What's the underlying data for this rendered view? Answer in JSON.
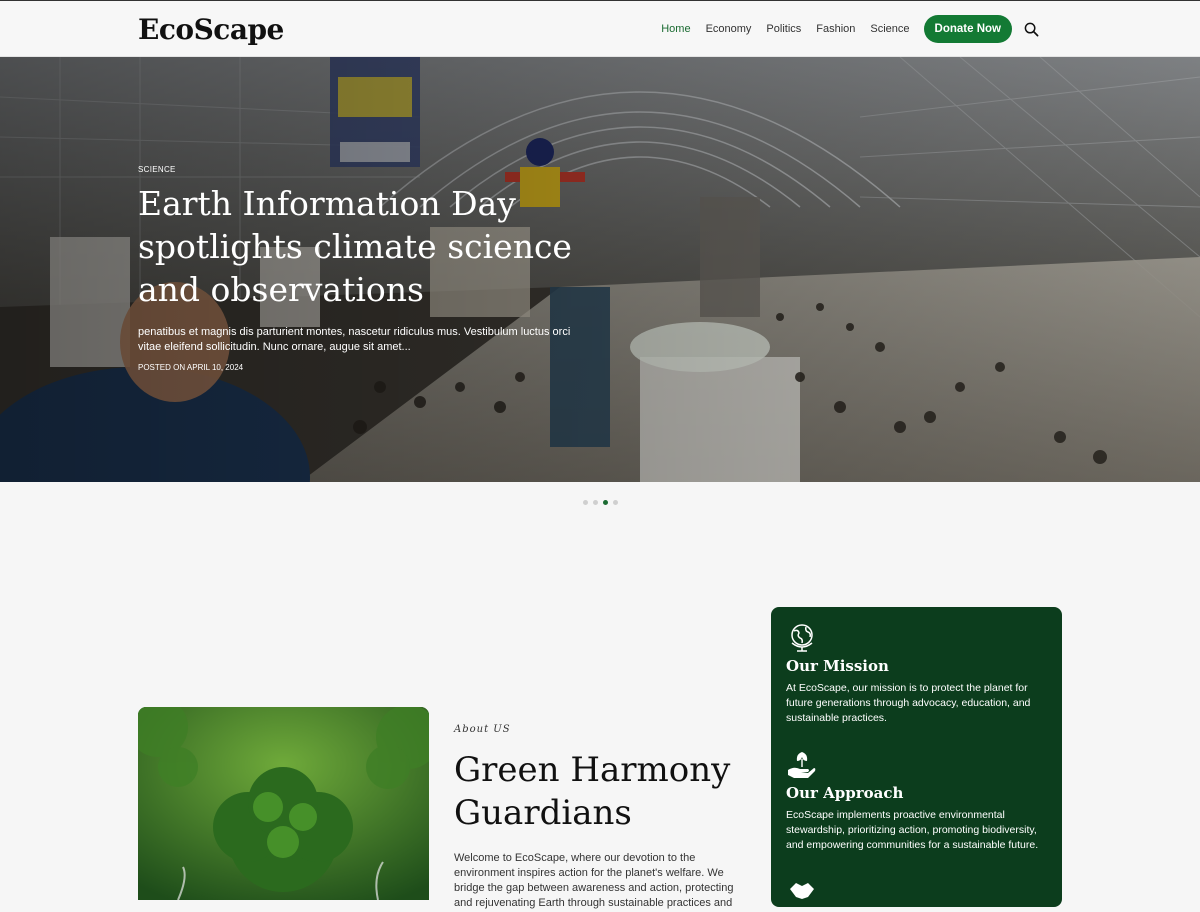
{
  "header": {
    "logo": "EcoScape",
    "nav": [
      "Home",
      "Economy",
      "Politics",
      "Fashion",
      "Science"
    ],
    "active_nav": "Home",
    "donate_label": "Donate Now",
    "accent": "#137a34"
  },
  "hero": {
    "category": "SCIENCE",
    "title": "Earth Information Day spotlights climate science and observations",
    "excerpt": "penatibus et magnis dis parturient montes, nascetur ridiculus mus. Vestibulum luctus orci vitae eleifend sollicitudin. Nunc ornare, augue sit amet...",
    "meta_prefix": "POSTED ON",
    "date": "APRIL 10, 2024",
    "slides": 4,
    "active_slide": 3
  },
  "about": {
    "eyebrow": "About US",
    "title": "Green Harmony Guardians",
    "body": "Welcome to EcoScape, where our devotion to the environment inspires action for the planet's welfare. We bridge the gap between awareness and action, protecting and rejuvenating Earth through sustainable practices and"
  },
  "mission_card": {
    "background": "#0c3d1d",
    "items": [
      {
        "icon": "globe-icon",
        "title": "Our Mission",
        "body": "At EcoScape, our mission is to protect the planet for future generations through advocacy, education, and sustainable practices."
      },
      {
        "icon": "hand-plant-icon",
        "title": "Our Approach",
        "body": "EcoScape implements proactive environmental stewardship, prioritizing action, promoting biodiversity, and empowering communities for a sustainable future."
      },
      {
        "icon": "handshake-icon",
        "title": "",
        "body": ""
      }
    ]
  }
}
